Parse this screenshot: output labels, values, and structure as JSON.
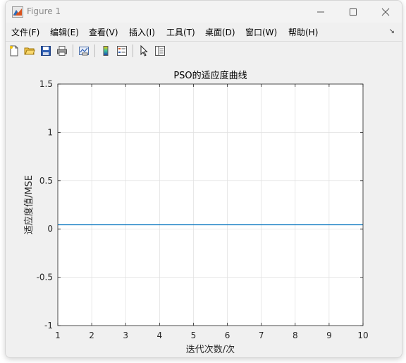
{
  "window": {
    "title": "Figure 1"
  },
  "menu": {
    "items": [
      "文件(F)",
      "编辑(E)",
      "查看(V)",
      "插入(I)",
      "工具(T)",
      "桌面(D)",
      "窗口(W)",
      "帮助(H)"
    ],
    "overflow_glyph": "↘"
  },
  "toolbar": {
    "buttons": [
      "new-figure",
      "open-file",
      "save",
      "print",
      "link-plot",
      "insert-colorbar",
      "insert-legend",
      "edit-plot-pointer",
      "property-editor"
    ]
  },
  "chart_data": {
    "type": "line",
    "title": "PSO的适应度曲线",
    "xlabel": "迭代次数/次",
    "ylabel": "适应度值/MSE",
    "xlim": [
      1,
      10
    ],
    "ylim": [
      -1,
      1.5
    ],
    "xticks": [
      "1",
      "2",
      "3",
      "4",
      "5",
      "6",
      "7",
      "8",
      "9",
      "10"
    ],
    "yticks": [
      "-1",
      "-0.5",
      "0",
      "0.5",
      "1",
      "1.5"
    ],
    "grid": true,
    "series": [
      {
        "x": [
          1,
          2,
          3,
          4,
          5,
          6,
          7,
          8,
          9,
          10
        ],
        "values": [
          0.045,
          0.045,
          0.045,
          0.045,
          0.045,
          0.045,
          0.045,
          0.045,
          0.045,
          0.045
        ],
        "color": "#0072bd"
      }
    ]
  }
}
